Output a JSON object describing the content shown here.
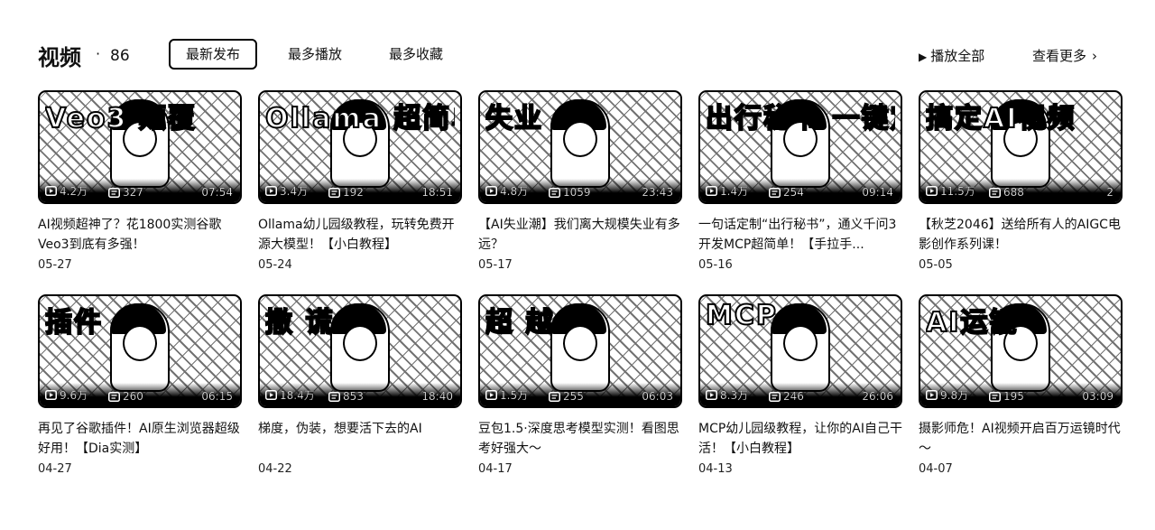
{
  "header": {
    "title": "视频",
    "dot": "·",
    "count": "86",
    "tabs": [
      {
        "label": "最新发布",
        "active": true
      },
      {
        "label": "最多播放",
        "active": false
      },
      {
        "label": "最多收藏",
        "active": false
      }
    ],
    "play_all_label": "播放全部",
    "view_more_label": "查看更多",
    "play_icon": "play-triangle-icon",
    "more_icon": "chevron-right-icon"
  },
  "videos": [
    {
      "thumb_text": "Veo3 颠覆",
      "views": "4.2万",
      "danmaku": "327",
      "duration": "07:54",
      "title": "AI视频超神了？花1800实测谷歌Veo3到底有多强！",
      "date": "05-27"
    },
    {
      "thumb_text": "Ollama 超简单",
      "views": "3.4万",
      "danmaku": "192",
      "duration": "18:51",
      "title": "Ollama幼儿园级教程，玩转免费开源大模型！【小白教程】",
      "date": "05-24"
    },
    {
      "thumb_text": "失业",
      "views": "4.8万",
      "danmaku": "1059",
      "duration": "23:43",
      "title": "【AI失业潮】我们离大规模失业有多远？",
      "date": "05-17"
    },
    {
      "thumb_text": "出行秘书 一键定制",
      "views": "1.4万",
      "danmaku": "254",
      "duration": "09:14",
      "title": "一句话定制“出行秘书”，通义千问3开发MCP超简单！【手拉手...",
      "date": "05-16"
    },
    {
      "thumb_text": "搞定AI视频",
      "views": "11.5万",
      "danmaku": "688",
      "duration": "2",
      "title": "【秋芝2046】送给所有人的AIGC电影创作系列课！",
      "date": "05-05"
    },
    {
      "thumb_text": "插件",
      "views": "9.6万",
      "danmaku": "260",
      "duration": "06:15",
      "title": "再见了谷歌插件！AI原生浏览器超级好用！【Dia实测】",
      "date": "04-27"
    },
    {
      "thumb_text": "撒 谎",
      "views": "18.4万",
      "danmaku": "853",
      "duration": "18:40",
      "title": "梯度，伪装，想要活下去的AI",
      "date": "04-22"
    },
    {
      "thumb_text": "超 越",
      "views": "1.5万",
      "danmaku": "255",
      "duration": "06:03",
      "title": "豆包1.5·深度思考模型实测！看图思考好强大～",
      "date": "04-17"
    },
    {
      "thumb_text": "MCP",
      "views": "8.3万",
      "danmaku": "246",
      "duration": "26:06",
      "title": "MCP幼儿园级教程，让你的AI自己干活！【小白教程】",
      "date": "04-13"
    },
    {
      "thumb_text": "AI运镜",
      "views": "9.8万",
      "danmaku": "195",
      "duration": "03:09",
      "title": "摄影师危！AI视频开启百万运镜时代～",
      "date": "04-07"
    }
  ]
}
